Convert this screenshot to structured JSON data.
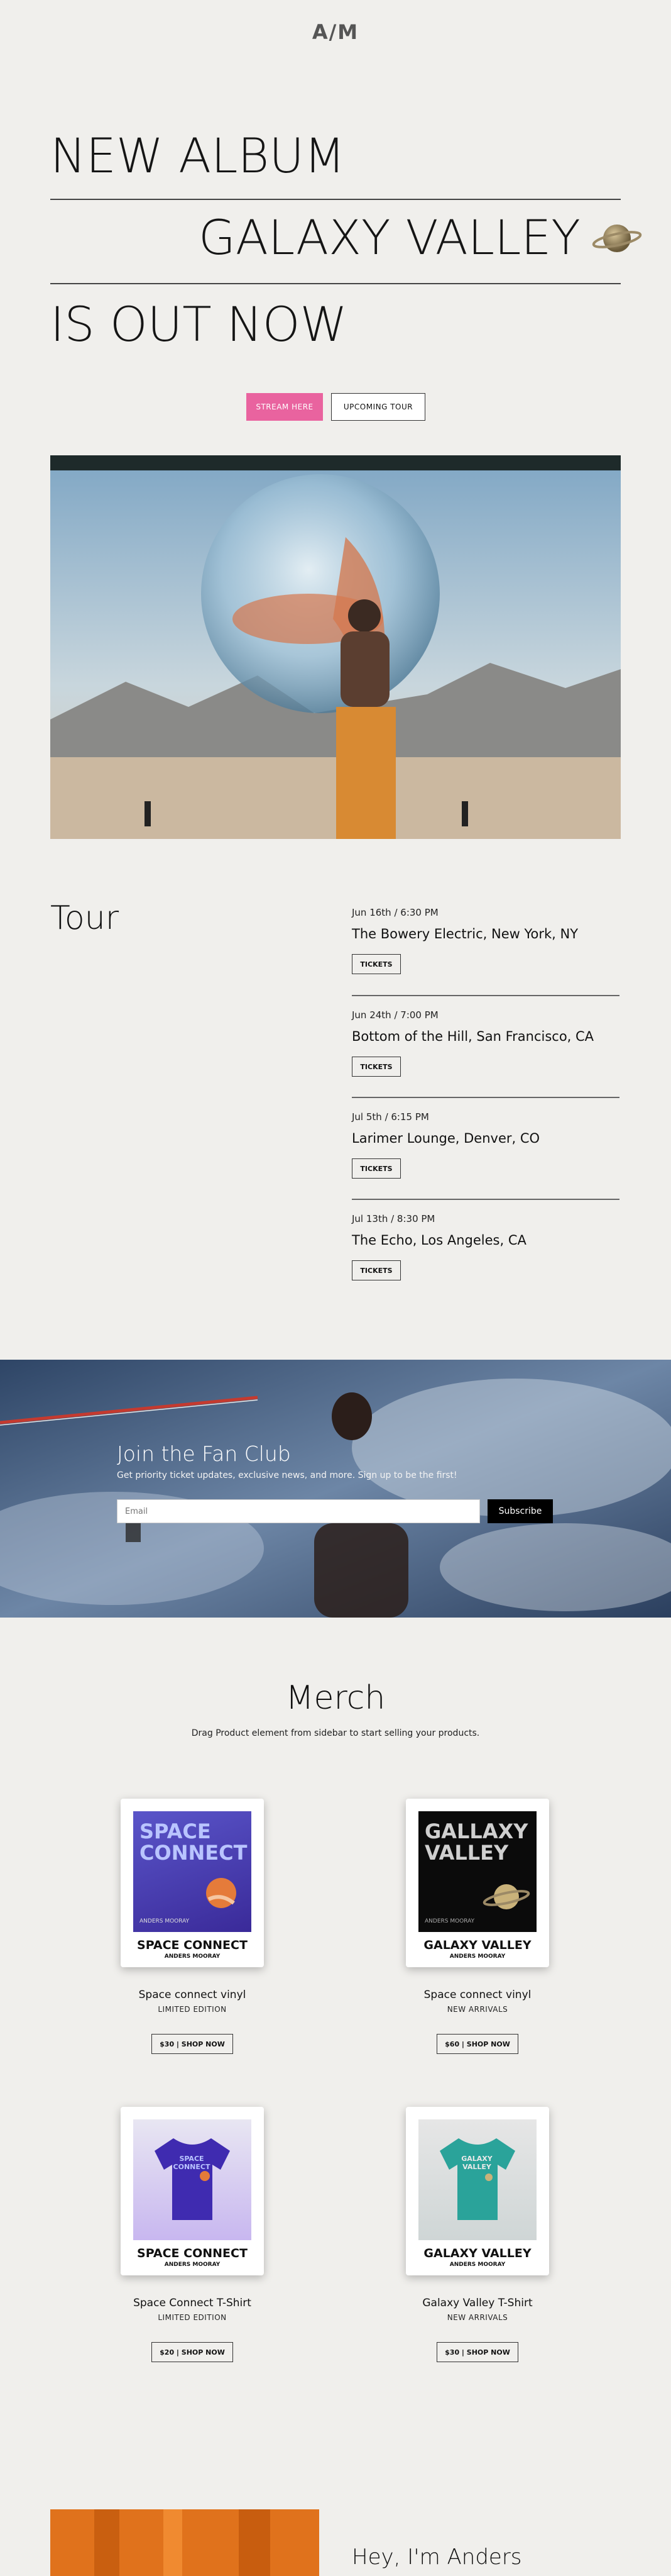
{
  "logo": "A/M",
  "hero": {
    "line1": "NEW ALBUM",
    "line2": "GALAXY VALLEY",
    "line3": "IS OUT NOW",
    "stream_label": "STREAM HERE",
    "tour_label": "UPCOMING TOUR"
  },
  "tour": {
    "title": "Tour",
    "gigs": [
      {
        "date": "Jun 16th / 6:30 PM",
        "venue": "The Bowery Electric, New York, NY",
        "button": "TICKETS"
      },
      {
        "date": "Jun 24th / 7:00 PM",
        "venue": "Bottom of the Hill, San Francisco, CA",
        "button": "TICKETS"
      },
      {
        "date": "Jul 5th / 6:15 PM",
        "venue": "Larimer Lounge, Denver, CO",
        "button": "TICKETS"
      },
      {
        "date": "Jul 13th / 8:30 PM",
        "venue": "The Echo, Los Angeles, CA",
        "button": "TICKETS"
      }
    ]
  },
  "fanclub": {
    "title": "Join the Fan Club",
    "subtitle": "Get priority ticket updates, exclusive news, and more. Sign up to be the first!",
    "email_placeholder": "Email",
    "subscribe_label": "Subscribe"
  },
  "merch": {
    "title": "Merch",
    "subtitle": "Drag Product element from sidebar to start selling your products.",
    "products": [
      {
        "card_name": "SPACE CONNECT",
        "card_sub": "ANDERS MOORAY",
        "art_title": "SPACE CONNECT",
        "art_caption": "ANDERS MOORAY",
        "title": "Space connect vinyl",
        "tag": "LIMITED EDITION",
        "price": "$30 | SHOP NOW"
      },
      {
        "card_name": "GALAXY VALLEY",
        "card_sub": "ANDERS MOORAY",
        "art_title": "GALLAXY VALLEY",
        "art_caption": "ANDERS MOORAY",
        "title": "Space connect vinyl",
        "tag": "NEW ARRIVALS",
        "price": "$60 | SHOP NOW"
      },
      {
        "card_name": "SPACE CONNECT",
        "card_sub": "ANDERS MOORAY",
        "art_title": "SPACE CONNECT",
        "title": "Space Connect T-Shirt",
        "tag": "LIMITED EDITION",
        "price": "$20 | SHOP NOW"
      },
      {
        "card_name": "GALAXY VALLEY",
        "card_sub": "ANDERS MOORAY",
        "art_title": "GALAXY VALLEY",
        "title": "Galaxy Valley T-Shirt",
        "tag": "NEW ARRIVALS",
        "price": "$30 | SHOP NOW"
      }
    ]
  },
  "about": {
    "greeting": "Hey, I'm Anders"
  },
  "colors": {
    "accent": "#e9639f",
    "background": "#f0efec",
    "text": "#111111"
  }
}
